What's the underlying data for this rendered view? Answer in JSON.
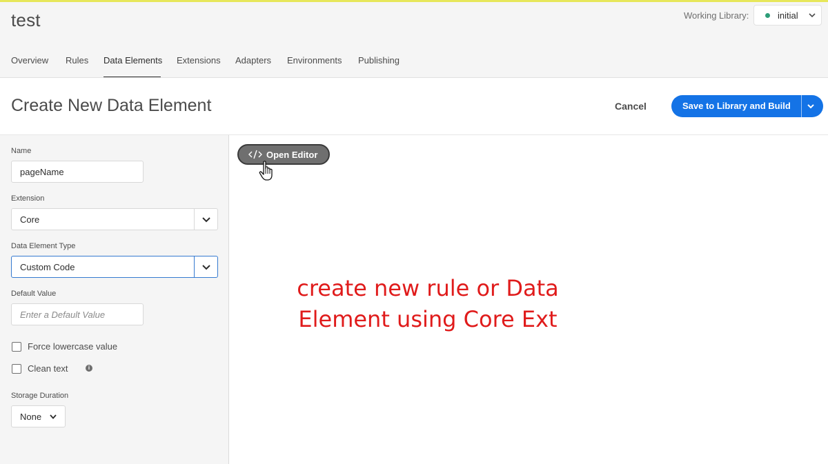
{
  "app": {
    "title": "test"
  },
  "working_library": {
    "label": "Working Library:",
    "value": "initial",
    "status_color": "#2d9d78"
  },
  "tabs": [
    {
      "label": "Overview"
    },
    {
      "label": "Rules"
    },
    {
      "label": "Data Elements",
      "active": true
    },
    {
      "label": "Extensions"
    },
    {
      "label": "Adapters"
    },
    {
      "label": "Environments"
    },
    {
      "label": "Publishing"
    }
  ],
  "header": {
    "title": "Create New Data Element",
    "cancel_label": "Cancel",
    "save_label": "Save to Library and Build",
    "accent": "#1473e6"
  },
  "form": {
    "name": {
      "label": "Name",
      "value": "pageName"
    },
    "extension": {
      "label": "Extension",
      "value": "Core"
    },
    "type": {
      "label": "Data Element Type",
      "value": "Custom Code"
    },
    "default_value": {
      "label": "Default Value",
      "placeholder": "Enter a Default Value"
    },
    "force_lowercase": {
      "label": "Force lowercase value",
      "checked": false
    },
    "clean_text": {
      "label": "Clean text",
      "checked": false,
      "info_icon": "info-icon"
    },
    "storage_duration": {
      "label": "Storage Duration",
      "value": "None"
    }
  },
  "editor": {
    "open_label": "Open Editor",
    "icon": "code-icon"
  },
  "annotation": {
    "line1": "create new rule or Data",
    "line2": "Element using Core Ext",
    "color": "#e01b1b"
  }
}
